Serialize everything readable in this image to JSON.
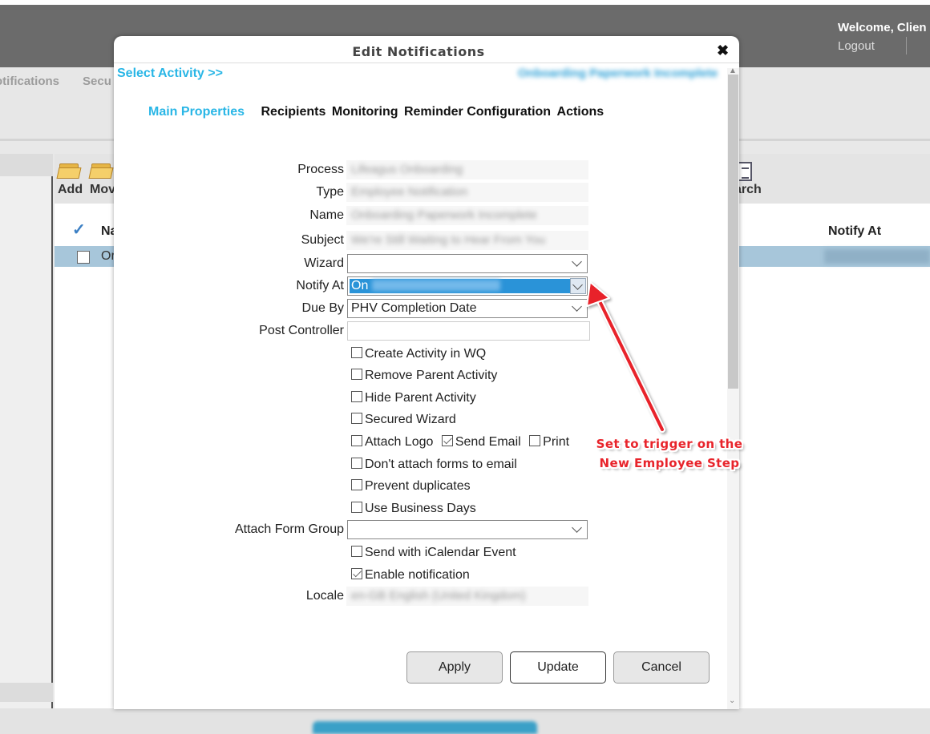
{
  "header": {
    "welcome": "Welcome, Clien",
    "logout": "Logout"
  },
  "subnav": {
    "notifications": "otifications",
    "security": "Secu"
  },
  "toolbar": {
    "add": "Add",
    "move": "Mov",
    "search": "arch"
  },
  "grid": {
    "columns": [
      "Na",
      "Notify At"
    ],
    "rows": [
      {
        "name": "Or"
      }
    ]
  },
  "modal": {
    "title": "Edit Notifications",
    "close": "✖",
    "select_activity": "Select Activity >>",
    "activity_name": "Onboarding Paperwork Incomplete",
    "tabs": [
      {
        "label": "Main Properties",
        "active": true
      },
      {
        "label": "Recipients",
        "active": false
      },
      {
        "label": "Monitoring",
        "active": false
      },
      {
        "label": "Reminder Configuration",
        "active": false
      },
      {
        "label": "Actions",
        "active": false
      }
    ],
    "fields": {
      "process": {
        "label": "Process",
        "value": "Lifeagus Onboarding"
      },
      "type": {
        "label": "Type",
        "value": "Employee Notification"
      },
      "name": {
        "label": "Name",
        "value": "Onboarding Paperwork Incomplete"
      },
      "subject": {
        "label": "Subject",
        "value": "We're Still Waiting to Hear From You"
      },
      "wizard": {
        "label": "Wizard",
        "value": ""
      },
      "notify_at": {
        "label": "Notify At",
        "value": "On",
        "value_hidden": "Paperwork Incomplete"
      },
      "due_by": {
        "label": "Due By",
        "value": "PHV Completion Date"
      },
      "post_controller": {
        "label": "Post Controller",
        "value": ""
      },
      "attach_form_group": {
        "label": "Attach Form Group",
        "value": ""
      },
      "locale": {
        "label": "Locale",
        "value": "en-GB English (United Kingdom)"
      }
    },
    "checkboxes": {
      "create_activity": {
        "label": "Create Activity in WQ",
        "checked": false
      },
      "remove_parent": {
        "label": "Remove Parent Activity",
        "checked": false
      },
      "hide_parent": {
        "label": "Hide Parent Activity",
        "checked": false
      },
      "secured_wizard": {
        "label": "Secured Wizard",
        "checked": false
      },
      "attach_logo": {
        "label": "Attach Logo",
        "checked": false
      },
      "send_email": {
        "label": "Send Email",
        "checked": true
      },
      "print": {
        "label": "Print",
        "checked": false
      },
      "dont_attach": {
        "label": "Don't attach forms to email",
        "checked": false
      },
      "prevent_duplicates": {
        "label": "Prevent duplicates",
        "checked": false
      },
      "business_days": {
        "label": "Use Business Days",
        "checked": false
      },
      "icalendar": {
        "label": "Send with iCalendar Event",
        "checked": false
      },
      "enable": {
        "label": "Enable notification",
        "checked": true
      }
    },
    "buttons": {
      "apply": "Apply",
      "update": "Update",
      "cancel": "Cancel"
    }
  },
  "annotation": {
    "line1": "Set to trigger on the",
    "line2": "New Employee Step",
    "color": "#e8242b"
  }
}
